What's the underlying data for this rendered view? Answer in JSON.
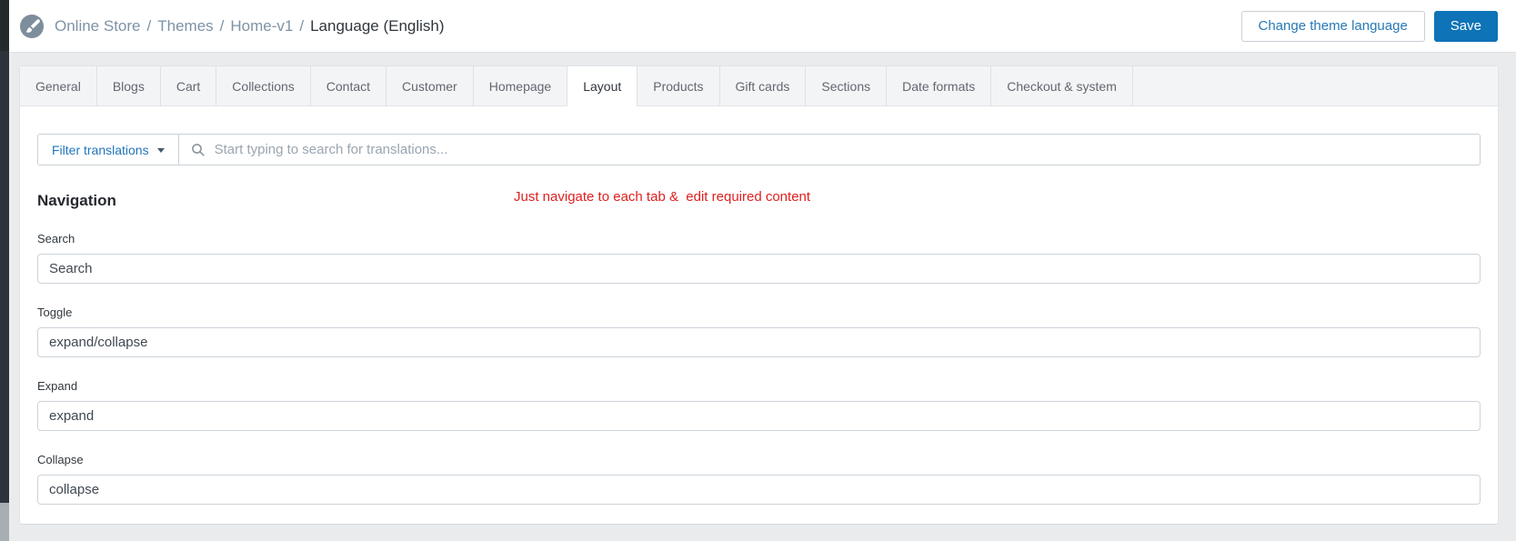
{
  "header": {
    "breadcrumb": {
      "items": [
        "Online Store",
        "Themes",
        "Home-v1"
      ],
      "separator": "/",
      "current": "Language (English)"
    },
    "change_language_label": "Change theme language",
    "save_label": "Save"
  },
  "tabs": {
    "items": [
      {
        "label": "General",
        "active": false
      },
      {
        "label": "Blogs",
        "active": false
      },
      {
        "label": "Cart",
        "active": false
      },
      {
        "label": "Collections",
        "active": false
      },
      {
        "label": "Contact",
        "active": false
      },
      {
        "label": "Customer",
        "active": false
      },
      {
        "label": "Homepage",
        "active": false
      },
      {
        "label": "Layout",
        "active": true
      },
      {
        "label": "Products",
        "active": false
      },
      {
        "label": "Gift cards",
        "active": false
      },
      {
        "label": "Sections",
        "active": false
      },
      {
        "label": "Date formats",
        "active": false
      },
      {
        "label": "Checkout & system",
        "active": false
      }
    ]
  },
  "filter": {
    "button_label": "Filter translations",
    "search_placeholder": "Start typing to search for translations..."
  },
  "annotation": "Just navigate to each tab &  edit required content",
  "section": {
    "title": "Navigation",
    "fields": [
      {
        "label": "Search",
        "value": "Search"
      },
      {
        "label": "Toggle",
        "value": "expand/collapse"
      },
      {
        "label": "Expand",
        "value": "expand"
      },
      {
        "label": "Collapse",
        "value": "collapse"
      }
    ]
  },
  "colors": {
    "accent_blue": "#0e73b7",
    "link_blue": "#2779b7",
    "breadcrumb_gray": "#7e93a6",
    "annotation_red": "#e01f1f",
    "tab_strip_gray": "#f3f4f6",
    "page_background": "#e9ebed"
  }
}
